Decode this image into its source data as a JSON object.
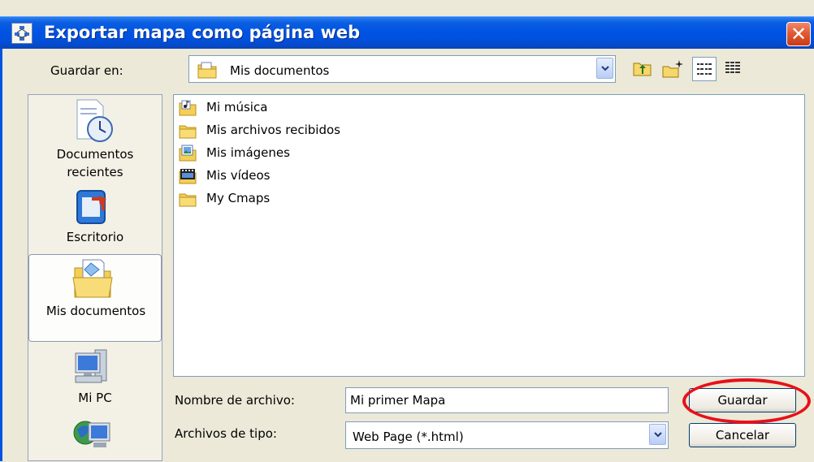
{
  "window": {
    "title": "Exportar mapa como página web",
    "close_glyph": "✕"
  },
  "save_in": {
    "label": "Guardar en:",
    "value": "Mis documentos"
  },
  "toolbar": {
    "up_icon": "up-one-level-icon",
    "new_folder_icon": "new-folder-icon",
    "list_view_icon": "list-view-icon",
    "details_view_icon": "details-view-icon"
  },
  "places": [
    {
      "label_line1": "Documentos",
      "label_line2": "recientes",
      "icon": "recent-documents-icon"
    },
    {
      "label": "Escritorio",
      "icon": "desktop-icon"
    },
    {
      "label": "Mis documentos",
      "icon": "my-documents-icon"
    },
    {
      "label": "Mi PC",
      "icon": "my-computer-icon"
    },
    {
      "label": "",
      "icon": "network-places-icon"
    }
  ],
  "files": [
    {
      "name": "Mi música",
      "icon": "music-folder-icon"
    },
    {
      "name": "Mis archivos recibidos",
      "icon": "folder-icon"
    },
    {
      "name": "Mis imágenes",
      "icon": "pictures-folder-icon"
    },
    {
      "name": "Mis vídeos",
      "icon": "videos-folder-icon"
    },
    {
      "name": "My Cmaps",
      "icon": "folder-icon"
    }
  ],
  "filename": {
    "label": "Nombre de archivo:",
    "value": "Mi primer Mapa"
  },
  "filetype": {
    "label": "Archivos de tipo:",
    "value": "Web Page (*.html)"
  },
  "buttons": {
    "save": "Guardar",
    "cancel": "Cancelar"
  },
  "colors": {
    "titlebar": "#0054e3",
    "dialog_bg": "#ece9d8",
    "highlight_ring": "#e8101a"
  }
}
